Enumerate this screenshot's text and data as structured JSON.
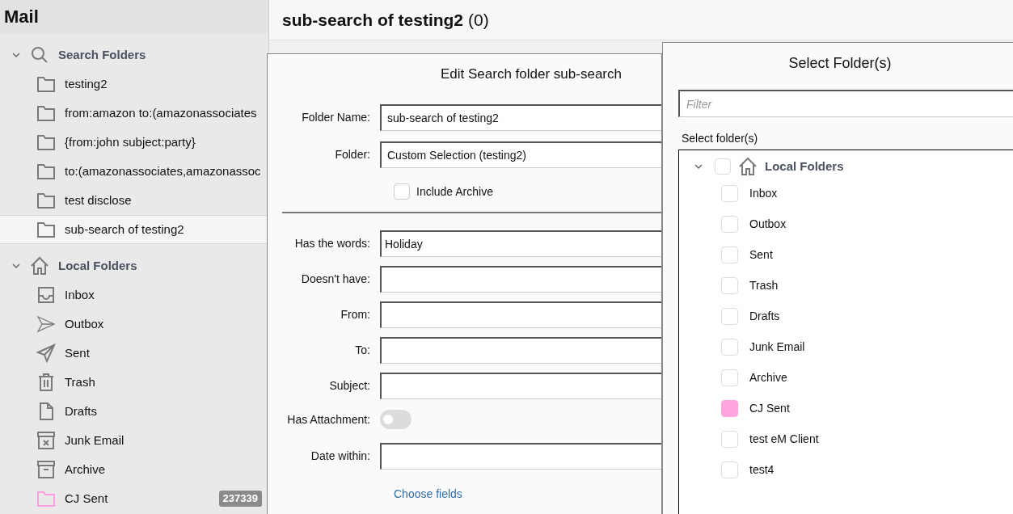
{
  "sidebar": {
    "title": "Mail",
    "sections": [
      {
        "label": "Search Folders",
        "expanded": true,
        "items": [
          {
            "label": "testing2",
            "selected": false
          },
          {
            "label": "from:amazon to:(amazonassociates",
            "selected": false
          },
          {
            "label": "{from:john subject:party}",
            "selected": false
          },
          {
            "label": "to:(amazonassociates,amazonassoc",
            "selected": false
          },
          {
            "label": "test disclose",
            "selected": false
          },
          {
            "label": "sub-search of testing2",
            "selected": true
          }
        ]
      },
      {
        "label": "Local Folders",
        "expanded": true,
        "items": [
          {
            "label": "Inbox",
            "selected": false
          },
          {
            "label": "Outbox",
            "selected": false
          },
          {
            "label": "Sent",
            "selected": false
          },
          {
            "label": "Trash",
            "selected": false
          },
          {
            "label": "Drafts",
            "selected": false
          },
          {
            "label": "Junk Email",
            "selected": false
          },
          {
            "label": "Archive",
            "selected": false
          },
          {
            "label": "CJ Sent",
            "selected": false,
            "color": "#ff9ee0",
            "badge": "237339"
          }
        ]
      }
    ]
  },
  "header": {
    "title": "sub-search of testing2",
    "count": "(0)"
  },
  "dialog": {
    "title": "Edit Search folder sub-search",
    "folder_name": {
      "label": "Folder Name:",
      "value": "sub-search of testing2"
    },
    "folder": {
      "label": "Folder:",
      "value": "Custom Selection (testing2)"
    },
    "include_archive": {
      "label": "Include Archive",
      "checked": false
    },
    "fields": [
      {
        "kind": "text",
        "label": "Has the words:",
        "value": "Holiday"
      },
      {
        "kind": "text",
        "label": "Doesn't have:"
      },
      {
        "kind": "text",
        "label": "From:"
      },
      {
        "kind": "text",
        "label": "To:"
      },
      {
        "kind": "text",
        "label": "Subject:"
      },
      {
        "kind": "toggle",
        "label": "Has Attachment:",
        "on": false
      },
      {
        "kind": "text",
        "label": "Date within:"
      }
    ],
    "choose_fields": "Choose fields"
  },
  "picker": {
    "title": "Select Folder(s)",
    "filter": {
      "placeholder": "Filter"
    },
    "list_label": "Select folder(s)",
    "root": {
      "label": "Local Folders",
      "expanded": true,
      "checked": false,
      "children": [
        {
          "label": "Inbox",
          "checked": false
        },
        {
          "label": "Outbox",
          "checked": false
        },
        {
          "label": "Sent",
          "checked": false
        },
        {
          "label": "Trash",
          "checked": false
        },
        {
          "label": "Drafts",
          "checked": false
        },
        {
          "label": "Junk Email",
          "checked": false
        },
        {
          "label": "Archive",
          "checked": false
        },
        {
          "label": "CJ Sent",
          "checked": false,
          "color": "#ffa6de"
        },
        {
          "label": "test eM Client",
          "checked": false
        },
        {
          "label": "test4",
          "checked": false
        }
      ]
    }
  }
}
